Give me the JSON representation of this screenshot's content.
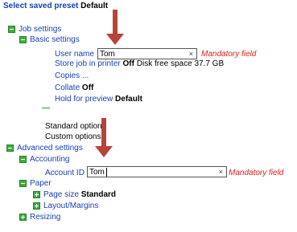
{
  "preset": {
    "label": "Select saved preset",
    "value": "Default"
  },
  "job_settings": {
    "label": "Job settings",
    "basic": {
      "label": "Basic settings",
      "user_name": {
        "label": "User name",
        "value": "Tom",
        "clear": "×",
        "mandatory": "Mandatory field"
      },
      "store_job": {
        "prefix": "Store job in",
        "link": "printer",
        "value": "Off",
        "extra": "Disk free space 37.7 GB"
      },
      "copies": "Copies ...",
      "collate": {
        "label": "Collate",
        "value": "Off"
      },
      "hold": {
        "label": "Hold for preview",
        "value": "Default"
      }
    },
    "standard_options": "Standard options",
    "custom_options": "Custom options"
  },
  "advanced": {
    "label": "Advanced settings",
    "accounting": {
      "label": "Accounting",
      "account_id": {
        "label": "Account ID",
        "value": "Tom",
        "clear": "×",
        "mandatory": "Mandatory field"
      }
    },
    "paper": {
      "label": "Paper",
      "page_size": {
        "label": "Page size",
        "value": "Standard"
      },
      "layout": "Layout/Margins"
    },
    "resizing": "Resizing"
  },
  "colors": {
    "arrow": "#b5453a",
    "link": "#1a3fb5",
    "tree_icon": "#3fae3f",
    "mandatory": "#e21b1b"
  }
}
